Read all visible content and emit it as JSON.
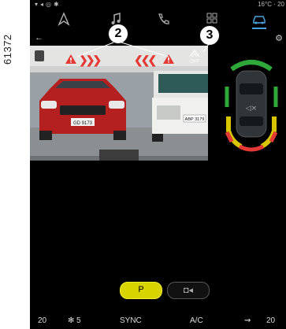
{
  "figure_number": "61372",
  "status_bar": {
    "temperature": "16°C · 20"
  },
  "nav": {
    "items": [
      {
        "name": "navigation-icon",
        "active": false
      },
      {
        "name": "music-icon",
        "active": false
      },
      {
        "name": "phone-icon",
        "active": false
      },
      {
        "name": "apps-icon",
        "active": false
      },
      {
        "name": "car-icon",
        "active": true
      }
    ]
  },
  "callouts": {
    "c2": "2",
    "c3": "3"
  },
  "camera": {
    "left_car_plate": "GD 9173",
    "right_car_plate": "ABP 3179",
    "off_label": "OFF"
  },
  "controls": {
    "assist_icon": "P",
    "camera_icon": "◘◂"
  },
  "climate": {
    "left_temp": "20",
    "fan_speed": "5",
    "sync_label": "SYNC",
    "ac_label": "A/C",
    "right_temp": "20"
  },
  "colors": {
    "accent": "#4aa3df",
    "warning_red": "#e53935",
    "sensor_green": "#2fa83a",
    "sensor_yellow": "#d9c400",
    "active_button": "#d8d400"
  }
}
